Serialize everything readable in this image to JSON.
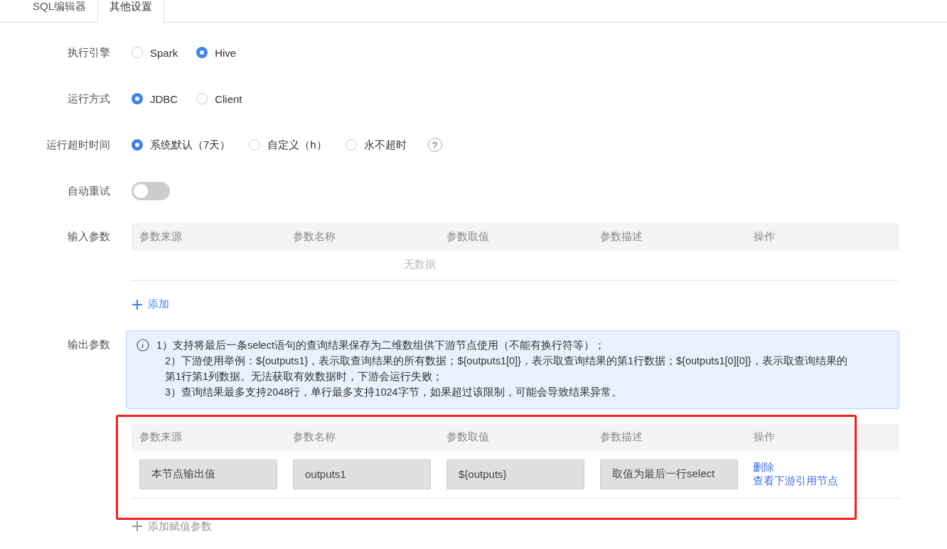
{
  "tabs": [
    {
      "label": "SQL编辑器",
      "selected": false
    },
    {
      "label": "其他设置",
      "selected": true
    }
  ],
  "form": [
    {
      "kind": "radio",
      "label": "执行引擎",
      "options": [
        {
          "label": "Spark",
          "selected": false
        },
        {
          "label": "Hive",
          "selected": true
        }
      ]
    },
    {
      "kind": "radio",
      "label": "运行方式",
      "options": [
        {
          "label": "JDBC",
          "selected": true
        },
        {
          "label": "Client",
          "selected": false
        }
      ]
    },
    {
      "kind": "radio",
      "label": "运行超时时间",
      "help": "?",
      "options": [
        {
          "label": "系统默认（7天）",
          "selected": true
        },
        {
          "label": "自定义（h）",
          "selected": false
        },
        {
          "label": "永不超时",
          "selected": false
        }
      ]
    },
    {
      "kind": "switch",
      "label": "自动重试",
      "on": false
    }
  ],
  "input_params": {
    "label": "输入参数",
    "columns": [
      "参数来源",
      "参数名称",
      "参数取值",
      "参数描述",
      "操作"
    ],
    "empty_text": "无数据",
    "add_link": {
      "label": "添加",
      "disabled": false
    }
  },
  "output_params": {
    "label": "输出参数",
    "notice": [
      "1）支持将最后一条select语句的查询结果保存为二维数组供下游节点使用（不能有换行符等）；",
      "2）下游使用举例：${outputs1}，表示取查询结果的所有数据；${outputs1[0]}，表示取查询结果的第1行数据；${outputs1[0][0]}，表示取查询结果的第1行第1列数据。无法获取有效数据时，下游会运行失败；",
      "3）查询结果最多支持2048行，单行最多支持1024字节，如果超过该限制，可能会导致结果异常。"
    ],
    "highlighted": true,
    "columns": [
      "参数来源",
      "参数名称",
      "参数取值",
      "参数描述",
      "操作"
    ],
    "rows": [
      {
        "source": "本节点输出值",
        "name": "outputs1",
        "value": "${outputs}",
        "description": "取值为最后一行select",
        "actions": [
          "删除",
          "查看下游引用节点"
        ]
      }
    ],
    "add_link": {
      "label": "添加赋值参数",
      "disabled": true
    }
  }
}
